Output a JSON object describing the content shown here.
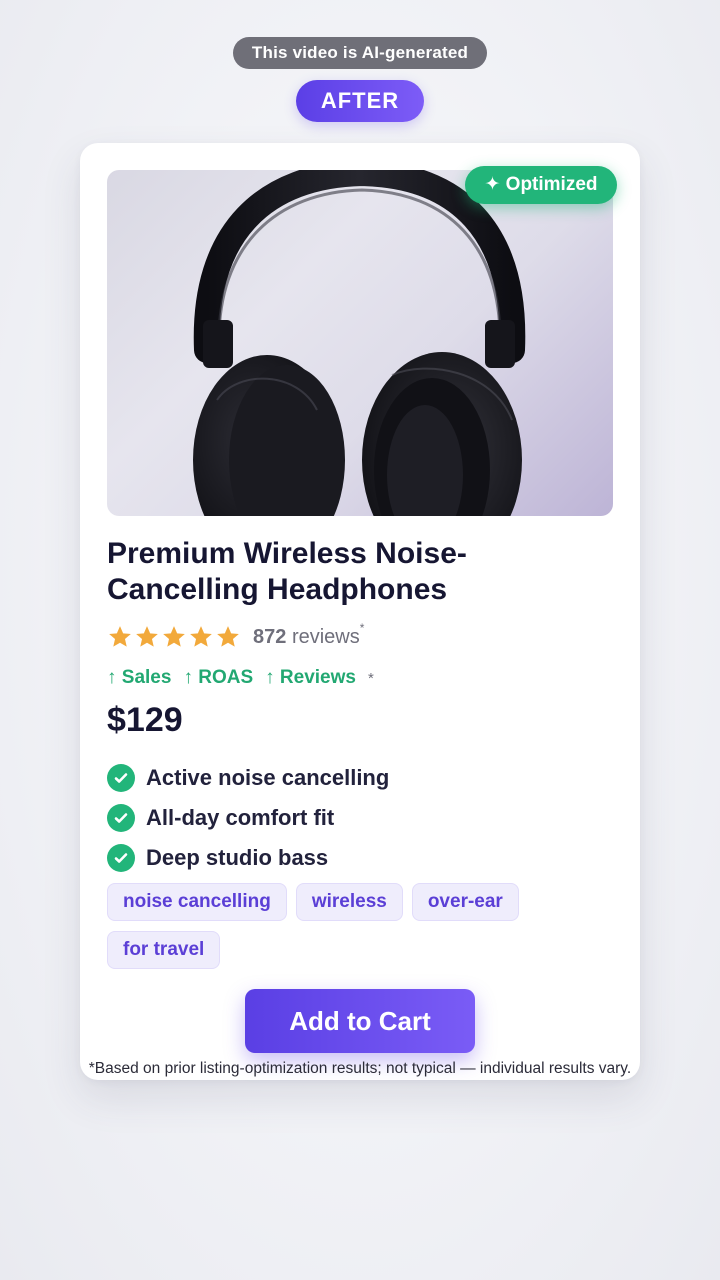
{
  "banner": {
    "ai_label": "This video is AI-generated"
  },
  "stage": {
    "label": "AFTER"
  },
  "product": {
    "badge": "✦ Optimized",
    "title": "Premium Wireless Noise-Cancelling Headphones",
    "rating": {
      "stars": 5,
      "count": "872",
      "count_suffix": "reviews",
      "asterisk": "*"
    },
    "metrics": [
      {
        "label": "↑ Sales"
      },
      {
        "label": "↑ ROAS"
      },
      {
        "label": "↑ Reviews"
      }
    ],
    "metrics_asterisk": "*",
    "price": "$129",
    "features": [
      "Active noise cancelling",
      "All-day comfort fit",
      "Deep studio bass"
    ],
    "tags": [
      "noise cancelling",
      "wireless",
      "over-ear",
      "for travel"
    ],
    "cta_label": "Add to Cart"
  },
  "disclaimer": "*Based on prior listing-optimization results; not typical — individual results vary.",
  "colors": {
    "accent_purple": "#6a4cf0",
    "success_green": "#22b57a",
    "star_gold": "#f2a93b",
    "title_text": "#161632"
  },
  "icons": {
    "star": "star-icon",
    "check": "check-circle-icon",
    "sparkle": "sparkle-icon",
    "arrow_up": "arrow-up-icon"
  }
}
